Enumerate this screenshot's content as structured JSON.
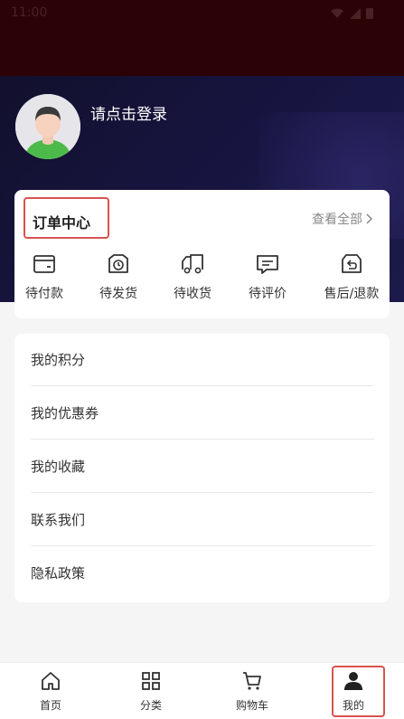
{
  "status_bar": {
    "time": "11:00"
  },
  "profile": {
    "login_prompt": "请点击登录"
  },
  "order_center": {
    "title": "订单中心",
    "view_all": "查看全部",
    "items": [
      {
        "label": "待付款",
        "icon": "wallet-icon"
      },
      {
        "label": "待发货",
        "icon": "clock-box-icon"
      },
      {
        "label": "待收货",
        "icon": "truck-icon"
      },
      {
        "label": "待评价",
        "icon": "comment-icon"
      },
      {
        "label": "售后/退款",
        "icon": "return-box-icon"
      }
    ]
  },
  "menu": {
    "items": [
      {
        "label": "我的积分"
      },
      {
        "label": "我的优惠券"
      },
      {
        "label": "我的收藏"
      },
      {
        "label": "联系我们"
      },
      {
        "label": "隐私政策"
      }
    ]
  },
  "tab_bar": {
    "tabs": [
      {
        "label": "首页",
        "icon": "home-icon"
      },
      {
        "label": "分类",
        "icon": "grid-icon"
      },
      {
        "label": "购物车",
        "icon": "cart-icon"
      },
      {
        "label": "我的",
        "icon": "user-icon"
      }
    ],
    "active_index": 3
  },
  "colors": {
    "header": "#2b0306",
    "hero": "#171540",
    "highlight": "#d9534f",
    "background": "#f5f5f5"
  }
}
